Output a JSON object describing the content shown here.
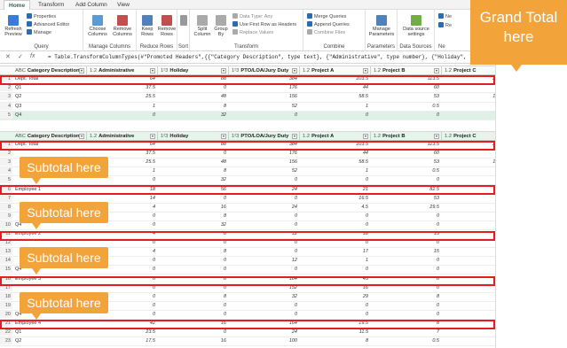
{
  "tabs": [
    "Home",
    "Transform",
    "Add Column",
    "View"
  ],
  "ribbon": {
    "groups": [
      {
        "label": "Query"
      },
      {
        "label": "Manage Columns"
      },
      {
        "label": "Reduce Rows"
      },
      {
        "label": "Sort"
      },
      {
        "label": "Transform"
      },
      {
        "label": "Combine"
      },
      {
        "label": "Parameters"
      },
      {
        "label": "Data Sources"
      },
      {
        "label": "Ne"
      }
    ],
    "buttons": {
      "refresh": "Refresh\nPreview",
      "properties": "Properties",
      "advanced": "Advanced Editor",
      "manage": "Manage",
      "choose": "Choose\nColumns",
      "remove_cols": "Remove\nColumns",
      "keep": "Keep\nRows",
      "remove_rows": "Remove\nRows",
      "split": "Split\nColumn",
      "group": "Group\nBy",
      "datatype": "Data Type: Any",
      "first_row": "Use First Row as Headers",
      "replace": "Replace Values",
      "merge": "Merge Queries",
      "append": "Append Queries",
      "combine": "Combine Files",
      "params": "Manage\nParameters",
      "ds": "Data source\nsettings",
      "ne": "Ne",
      "re": "Re"
    }
  },
  "formula": {
    "text": "= Table.TransformColumnTypes(#\"Promoted Headers\",{{\"Category Description\", type text}, {\"Administrative\", type number}, {\"Holiday\", Int64.Typ"
  },
  "columns": [
    {
      "type": "ABC",
      "label": "Category Description"
    },
    {
      "type": "1.2",
      "label": "Administrative"
    },
    {
      "type": "1²3",
      "label": "Holiday"
    },
    {
      "type": "1²3",
      "label": "PTO/LOA/Jury Duty"
    },
    {
      "type": "1.2",
      "label": "Project A"
    },
    {
      "type": "1.2",
      "label": "Project B"
    },
    {
      "type": "1.2",
      "label": "Project C"
    }
  ],
  "top_rows": [
    {
      "n": "1",
      "c": [
        "Dept. Total",
        "64",
        "88",
        "384",
        "103.5",
        "113.5",
        "292.5"
      ]
    },
    {
      "n": "2",
      "c": [
        "Q1",
        "37.5",
        "0",
        "176",
        "44",
        "60",
        "122"
      ]
    },
    {
      "n": "3",
      "c": [
        "Q2",
        "25.5",
        "48",
        "156",
        "58.5",
        "53",
        "160.5"
      ]
    },
    {
      "n": "4",
      "c": [
        "Q3",
        "1",
        "8",
        "52",
        "1",
        "0.5",
        "10"
      ]
    },
    {
      "n": "5",
      "c": [
        "Q4",
        "0",
        "32",
        "0",
        "0",
        "0",
        "0"
      ]
    }
  ],
  "bottom_rows": [
    {
      "n": "1",
      "c": [
        "Dept. Total",
        "64",
        "88",
        "384",
        "103.5",
        "113.5",
        "292.5"
      ]
    },
    {
      "n": "2",
      "c": [
        "",
        "37.5",
        "0",
        "176",
        "44",
        "60",
        "122"
      ]
    },
    {
      "n": "3",
      "c": [
        "",
        "25.5",
        "48",
        "156",
        "58.5",
        "53",
        "160.5"
      ]
    },
    {
      "n": "4",
      "c": [
        "",
        "1",
        "8",
        "52",
        "1",
        "0.5",
        "10"
      ]
    },
    {
      "n": "5",
      "c": [
        "",
        "0",
        "32",
        "0",
        "0",
        "0",
        "0"
      ]
    },
    {
      "n": "6",
      "c": [
        "Employee 1",
        "18",
        "56",
        "24",
        "21",
        "82.5",
        "63"
      ]
    },
    {
      "n": "7",
      "c": [
        "",
        "14",
        "0",
        "0",
        "16.5",
        "53",
        "60.5"
      ]
    },
    {
      "n": "8",
      "c": [
        "",
        "4",
        "16",
        "24",
        "4.5",
        "29.5",
        "2.5"
      ]
    },
    {
      "n": "9",
      "c": [
        "",
        "0",
        "8",
        "0",
        "0",
        "0",
        "0"
      ]
    },
    {
      "n": "10",
      "c": [
        "Q4",
        "0",
        "32",
        "0",
        "0",
        "0",
        "0"
      ]
    },
    {
      "n": "11",
      "c": [
        "Employee 2",
        "4",
        "8",
        "12",
        "18",
        "15",
        "93"
      ]
    },
    {
      "n": "12",
      "c": [
        "",
        "0",
        "0",
        "0",
        "0",
        "0",
        "0"
      ]
    },
    {
      "n": "13",
      "c": [
        "",
        "4",
        "8",
        "0",
        "17",
        "15",
        "83"
      ]
    },
    {
      "n": "14",
      "c": [
        "",
        "0",
        "0",
        "12",
        "1",
        "0",
        "10"
      ]
    },
    {
      "n": "15",
      "c": [
        "Q4",
        "0",
        "0",
        "0",
        "0",
        "0",
        "0"
      ]
    },
    {
      "n": "16",
      "c": [
        "Employee 3",
        "0",
        "8",
        "184",
        "45",
        "8",
        "114"
      ]
    },
    {
      "n": "17",
      "c": [
        "",
        "0",
        "0",
        "152",
        "16",
        "0",
        "48"
      ]
    },
    {
      "n": "18",
      "c": [
        "",
        "0",
        "8",
        "32",
        "29",
        "8",
        "66"
      ]
    },
    {
      "n": "19",
      "c": [
        "",
        "0",
        "0",
        "0",
        "0",
        "0",
        "0"
      ]
    },
    {
      "n": "20",
      "c": [
        "Q4",
        "0",
        "0",
        "0",
        "0",
        "0",
        "0"
      ]
    },
    {
      "n": "21",
      "c": [
        "Employee 4",
        "42",
        "16",
        "164",
        "19.5",
        "8",
        "22.5"
      ]
    },
    {
      "n": "22",
      "c": [
        "Q1",
        "23.5",
        "0",
        "24",
        "11.5",
        "7",
        "13.5"
      ]
    },
    {
      "n": "23",
      "c": [
        "Q2",
        "17.5",
        "16",
        "100",
        "8",
        "0.5",
        "9"
      ]
    }
  ],
  "callouts": {
    "grand": "Grand Total here",
    "sub": "Subtotal here"
  }
}
